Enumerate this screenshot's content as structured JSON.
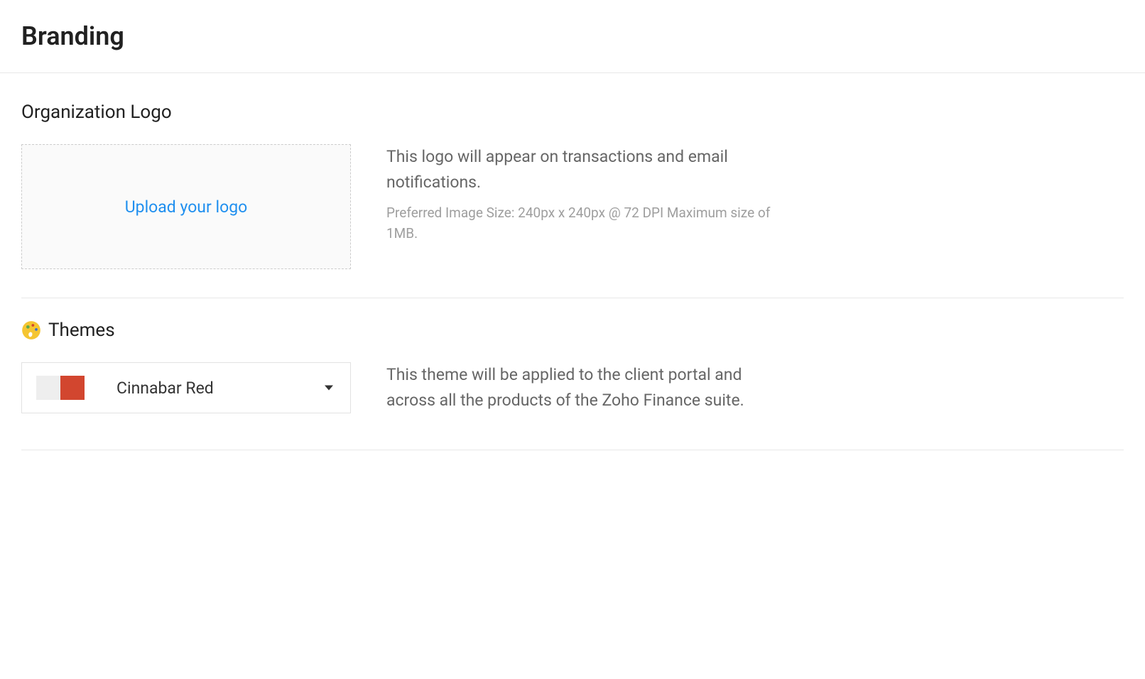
{
  "header": {
    "title": "Branding"
  },
  "logo_section": {
    "title": "Organization Logo",
    "upload_label": "Upload your logo",
    "description": "This logo will appear on transactions and email notifications.",
    "hint": "Preferred Image Size: 240px x 240px @ 72 DPI Maximum size of 1MB."
  },
  "themes_section": {
    "title": "Themes",
    "selected_theme": "Cinnabar Red",
    "swatch_light": "#eeeeee",
    "swatch_accent": "#d2462f",
    "description": "This theme will be applied to the client portal and across all the products of the Zoho Finance suite."
  }
}
